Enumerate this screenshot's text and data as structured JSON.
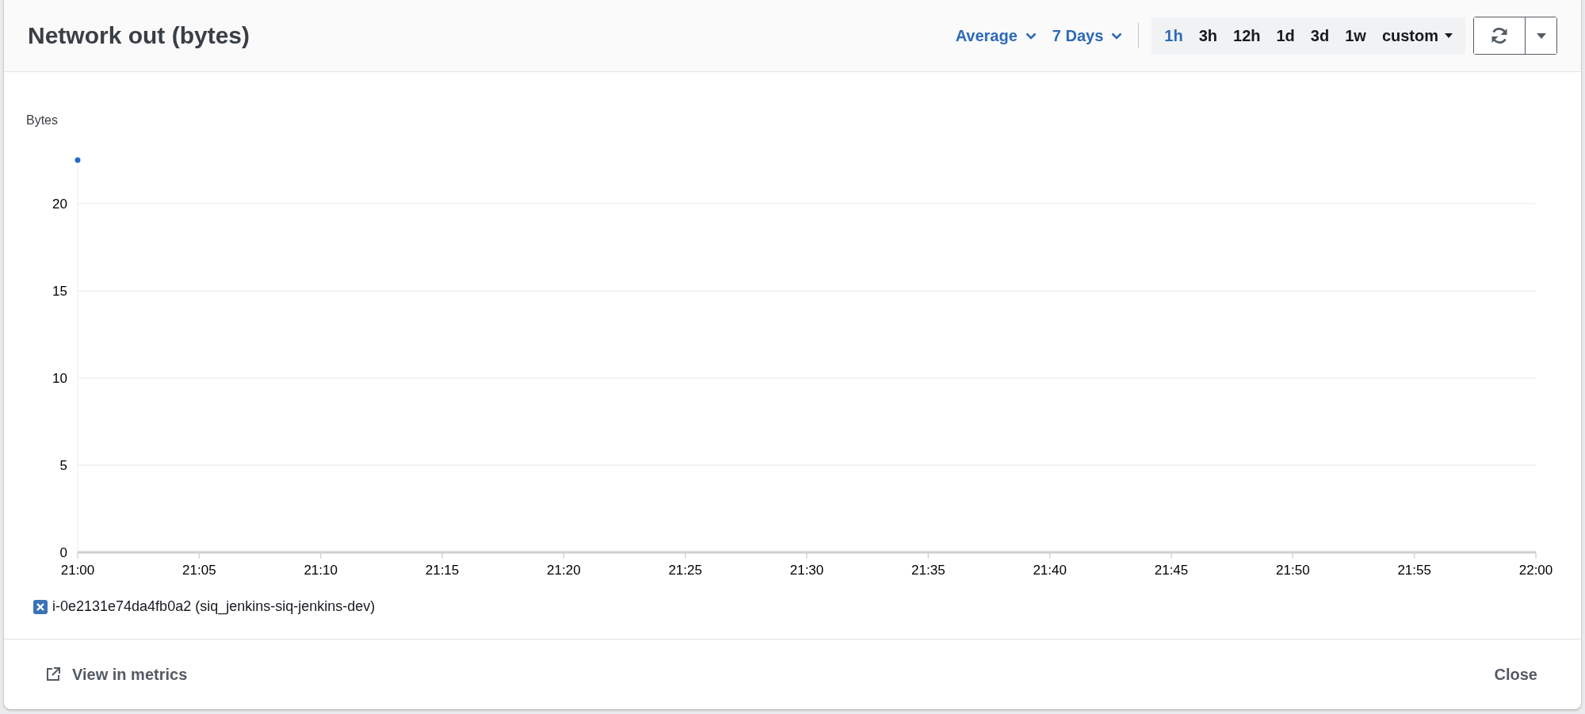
{
  "title": "Network out (bytes)",
  "statistic": {
    "label": "Average"
  },
  "period": {
    "label": "7 Days"
  },
  "ranges": [
    {
      "label": "1h",
      "selected": true,
      "kind": "preset"
    },
    {
      "label": "3h",
      "selected": false,
      "kind": "preset"
    },
    {
      "label": "12h",
      "selected": false,
      "kind": "preset"
    },
    {
      "label": "1d",
      "selected": false,
      "kind": "preset"
    },
    {
      "label": "3d",
      "selected": false,
      "kind": "preset"
    },
    {
      "label": "1w",
      "selected": false,
      "kind": "preset"
    },
    {
      "label": "custom",
      "selected": false,
      "kind": "dropdown"
    }
  ],
  "chart_data": {
    "type": "line",
    "ylabel": "Bytes",
    "categories": [
      "21:00",
      "21:05",
      "21:10",
      "21:15",
      "21:20",
      "21:25",
      "21:30",
      "21:35",
      "21:40",
      "21:45",
      "21:50",
      "21:55",
      "22:00"
    ],
    "ylim": [
      0,
      22.5
    ],
    "yticks": [
      0,
      5,
      10,
      15,
      20
    ],
    "grid": true,
    "series": [
      {
        "name": "i-0e2131e74da4fb0a2 (siq_jenkins-siq-jenkins-dev)",
        "color": "#1f6fc5",
        "marker": "circle",
        "values": [
          22.5,
          null,
          null,
          null,
          null,
          null,
          null,
          null,
          null,
          null,
          null,
          null,
          null
        ]
      }
    ]
  },
  "legend": [
    {
      "checked": true
    }
  ],
  "footer": {
    "link": "View in metrics",
    "close": "Close"
  }
}
